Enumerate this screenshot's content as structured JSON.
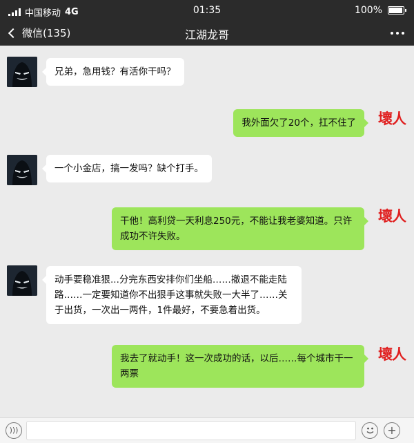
{
  "status_bar": {
    "carrier": "中国移动",
    "network": "4G",
    "time": "01:35",
    "battery_text": "100%",
    "battery_level": 1.0
  },
  "nav": {
    "back_label": "微信(135)",
    "title": "江湖龙哥",
    "more_icon": "more-dots-icon"
  },
  "colors": {
    "header_bg": "#2b2b2b",
    "chat_bg": "#ebebeb",
    "outgoing_bubble": "#9de55b",
    "incoming_bubble": "#ffffff",
    "stamp_red": "#e02020"
  },
  "messages": [
    {
      "from": "other",
      "text": "兄弟，急用钱？有活你干吗？"
    },
    {
      "from": "me",
      "text": "我外面欠了20个，扛不住了"
    },
    {
      "from": "other",
      "text": "一个小金店，搞一发吗？缺个打手。"
    },
    {
      "from": "me",
      "text": "干他！高利贷一天利息250元，不能让我老婆知道。只许成功不许失败。"
    },
    {
      "from": "other",
      "text": "动手要稳准狠...分完东西安排你们坐船……撤退不能走陆路……一定要知道你不出狠手这事就失败一大半了……关于出货，一次出一两件，1件最好，不要急着出货。"
    },
    {
      "from": "me",
      "text": "我去了就动手！这一次成功的话，以后……每个城市干一两票"
    }
  ],
  "my_avatar_text": "壞人",
  "input_bar": {
    "voice_icon": "voice-icon",
    "emoji_icon": "emoji-icon",
    "plus_icon": "plus-icon"
  }
}
